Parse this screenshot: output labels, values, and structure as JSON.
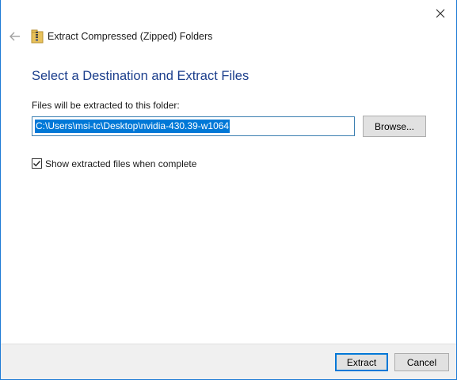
{
  "window": {
    "title": "Extract Compressed (Zipped) Folders"
  },
  "icons": {
    "close": "close-icon",
    "back": "back-arrow-icon",
    "zip": "zip-folder-icon",
    "check": "checkmark-icon"
  },
  "content": {
    "heading": "Select a Destination and Extract Files",
    "folder_label": "Files will be extracted to this folder:",
    "path_value": "C:\\Users\\msi-tc\\Desktop\\nvidia-430.39-w1064",
    "browse_label": "Browse...",
    "show_files_label": "Show extracted files when complete",
    "show_files_checked": true
  },
  "footer": {
    "extract_label": "Extract",
    "cancel_label": "Cancel"
  },
  "colors": {
    "accent": "#0078d7",
    "heading": "#1b3e8c",
    "border": "#1e7bd6"
  }
}
